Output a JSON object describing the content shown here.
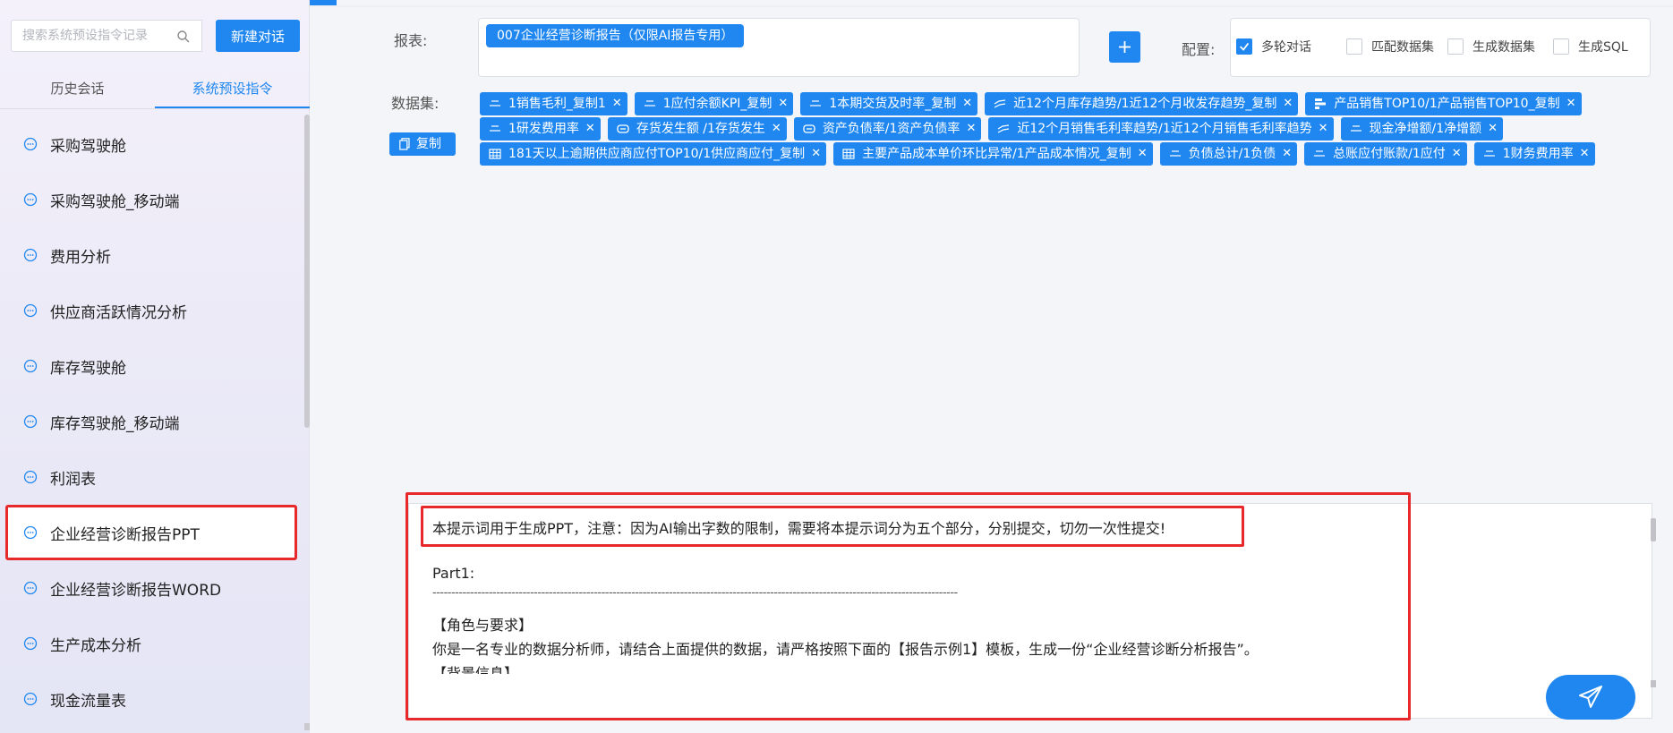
{
  "sidebar": {
    "search_placeholder": "搜索系统预设指令记录",
    "new_button": "新建对话",
    "tabs": [
      {
        "label": "历史会话",
        "active": false
      },
      {
        "label": "系统预设指令",
        "active": true
      }
    ],
    "items": [
      {
        "label": "采购驾驶舱"
      },
      {
        "label": "采购驾驶舱_移动端"
      },
      {
        "label": "费用分析"
      },
      {
        "label": "供应商活跃情况分析"
      },
      {
        "label": "库存驾驶舱"
      },
      {
        "label": "库存驾驶舱_移动端"
      },
      {
        "label": "利润表"
      },
      {
        "label": "企业经营诊断报告PPT",
        "selected": true
      },
      {
        "label": "企业经营诊断报告WORD"
      },
      {
        "label": "生产成本分析"
      },
      {
        "label": "现金流量表"
      }
    ]
  },
  "form": {
    "report_label": "报表:",
    "report_tag": "007企业经营诊断报告（仅限AI报告专用）",
    "config_label": "配置:",
    "configs": [
      {
        "label": "多轮对话",
        "checked": true
      },
      {
        "label": "匹配数据集",
        "checked": false
      },
      {
        "label": "生成数据集",
        "checked": false
      },
      {
        "label": "生成SQL",
        "checked": false
      }
    ],
    "dataset_label": "数据集:",
    "copy_button": "复制",
    "datasets": [
      [
        {
          "icon": "list-icon",
          "label": "1销售毛利_复制1"
        },
        {
          "icon": "list-icon",
          "label": "1应付余额KPI_复制"
        },
        {
          "icon": "list-icon",
          "label": "1本期交货及时率_复制"
        },
        {
          "icon": "line-chart-icon",
          "label": "近12个月库存趋势/1近12个月收发存趋势_复制"
        },
        {
          "icon": "bar-chart-icon",
          "label": "产品销售TOP10/1产品销售TOP10_复制"
        }
      ],
      [
        {
          "icon": "list-icon",
          "label": "1研发费用率"
        },
        {
          "icon": "kpi-icon",
          "label": "存货发生额 /1存货发生"
        },
        {
          "icon": "kpi-icon",
          "label": "资产负债率/1资产负债率"
        },
        {
          "icon": "line-chart-icon",
          "label": "近12个月销售毛利率趋势/1近12个月销售毛利率趋势"
        },
        {
          "icon": "list-icon",
          "label": "现金净增额/1净增额"
        }
      ],
      [
        {
          "icon": "table-icon",
          "label": "181天以上逾期供应商应付TOP10/1供应商应付_复制"
        },
        {
          "icon": "table-icon",
          "label": "主要产品成本单价环比异常/1产品成本情况_复制"
        },
        {
          "icon": "list-icon",
          "label": "负债总计/1负债"
        },
        {
          "icon": "list-icon",
          "label": "总账应付账款/1应付"
        },
        {
          "icon": "list-icon",
          "label": "1财务费用率"
        }
      ]
    ]
  },
  "prompt": {
    "lines": [
      "本提示词用于生成PPT，注意：因为AI输出字数的限制，需要将本提示词分为五个部分，分别提交，切勿一次性提交!",
      "",
      "Part1:",
      "--------------------------------------------------------------------------------------------------------------------------------------------",
      "【角色与要求】",
      "你是一名专业的数据分析师，请结合上面提供的数据，请严格按照下面的【报告示例1】模板，生成一份“企业经营诊断分析报告”。",
      "【背景信息】"
    ]
  },
  "colors": {
    "accent": "#1f87ef",
    "highlight": "#e8292b"
  }
}
